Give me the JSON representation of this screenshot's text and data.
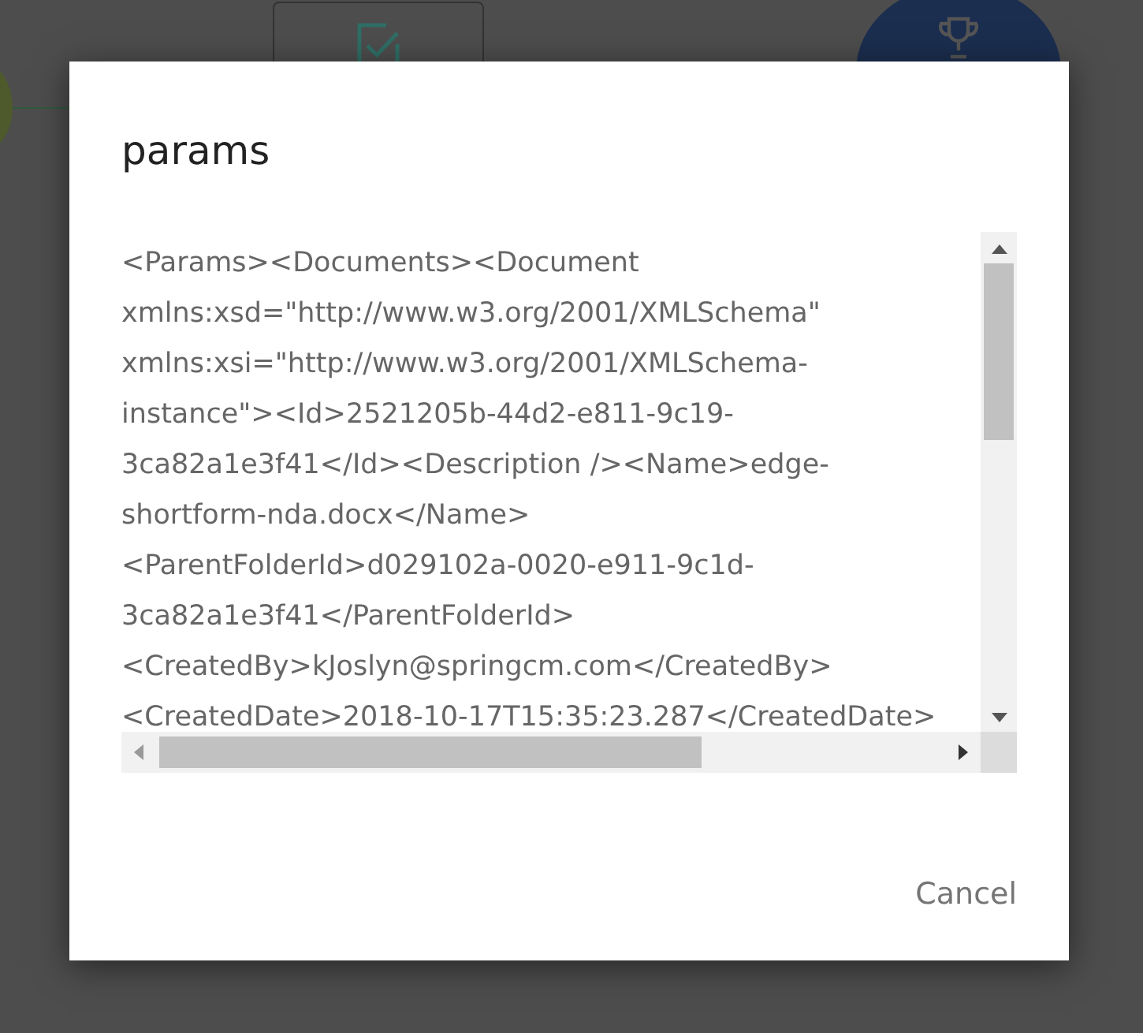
{
  "dialog": {
    "title": "params",
    "content_lines": [
      "<Params><Documents><Document",
      "xmlns:xsd=\"http://www.w3.org/2001/XMLSchema\"",
      "xmlns:xsi=\"http://www.w3.org/2001/XMLSchema-",
      "instance\"><Id>2521205b-44d2-e811-9c19-",
      "3ca82a1e3f41</Id><Description /><Name>edge-",
      "shortform-nda.docx</Name>",
      "<ParentFolderId>d029102a-0020-e911-9c1d-",
      "3ca82a1e3f41</ParentFolderId>",
      "<CreatedBy>kJoslyn@springcm.com</CreatedBy>",
      "<CreatedDate>2018-10-17T15:35:23.287</CreatedDate>"
    ],
    "buttons": [
      "Cancel"
    ]
  }
}
